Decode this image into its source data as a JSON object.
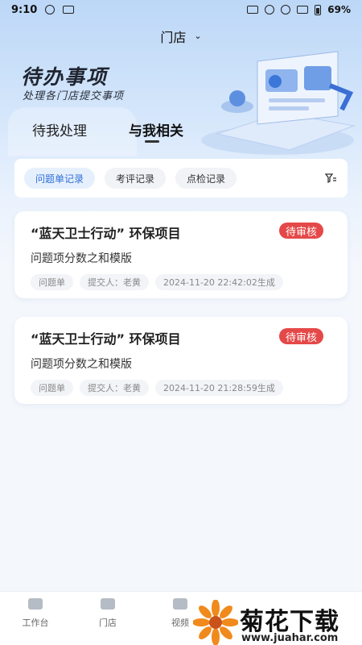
{
  "status_bar": {
    "time": "9:10",
    "battery": "69%"
  },
  "store_selector": {
    "label": "门店"
  },
  "hero": {
    "title": "待办事项",
    "subtitle": "处理各门店提交事项"
  },
  "tabs": [
    {
      "label": "待我处理"
    },
    {
      "label": "与我相关"
    }
  ],
  "filter": {
    "chips": [
      {
        "label": "问题单记录"
      },
      {
        "label": "考评记录"
      },
      {
        "label": "点检记录"
      }
    ],
    "icon": "filter-icon"
  },
  "cards": [
    {
      "title": "“蓝天卫士行动” 环保项目",
      "status": "待审核",
      "subtitle": "问题项分数之和模版",
      "type": "问题单",
      "submitter": "提交人：老黄",
      "generated": "2024-11-20 22:42:02生成"
    },
    {
      "title": "“蓝天卫士行动” 环保项目",
      "status": "待审核",
      "subtitle": "问题项分数之和模版",
      "type": "问题单",
      "submitter": "提交人：老黄",
      "generated": "2024-11-20 21:28:59生成"
    }
  ],
  "bottom_nav": [
    {
      "label": "工作台"
    },
    {
      "label": "门店"
    },
    {
      "label": "视频"
    }
  ],
  "watermark": {
    "text": "菊花下载网",
    "url": "www.juahar.com"
  },
  "colors": {
    "accent": "#2f6fd8",
    "badge": "#e54848"
  }
}
